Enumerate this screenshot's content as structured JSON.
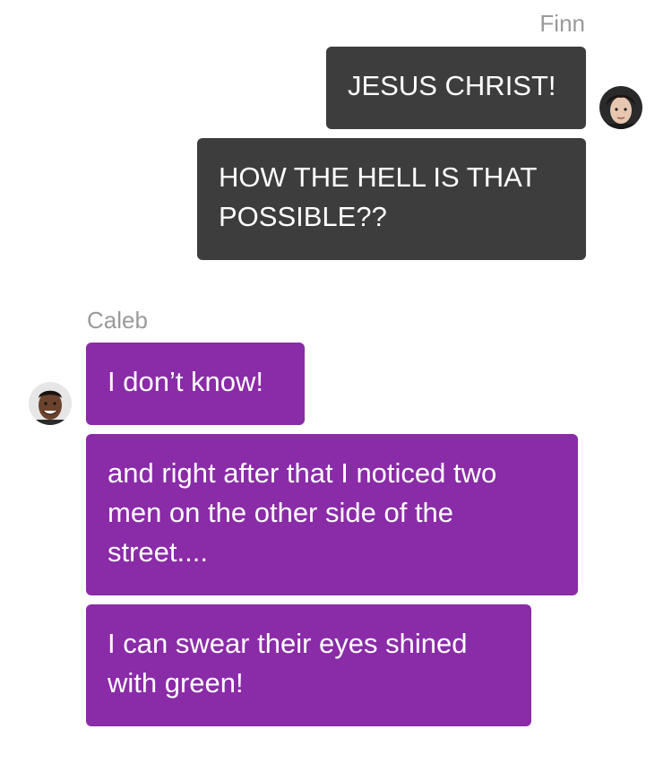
{
  "conversation": {
    "outgoing": {
      "sender": "Finn",
      "messages": [
        "JESUS CHRIST!",
        "HOW THE HELL IS THAT POSSIBLE??"
      ]
    },
    "incoming": {
      "sender": "Caleb",
      "messages": [
        "I don’t know!",
        "and right after that I noticed two men on the other side of the street....",
        "I can swear their eyes shined with green!"
      ]
    }
  },
  "colors": {
    "outgoing_bubble": "#3d3d3d",
    "incoming_bubble": "#8a2ba8",
    "sender_name": "#9a9a9a"
  }
}
